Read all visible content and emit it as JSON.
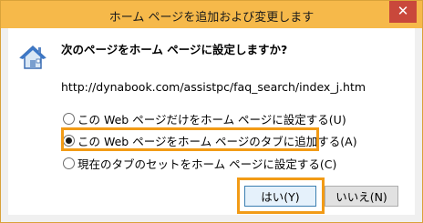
{
  "window": {
    "title": "ホーム ページを追加および変更します",
    "close_glyph": "✕"
  },
  "dialog": {
    "icon": "house-icon",
    "question": "次のページをホーム ページに設定しますか?",
    "url": "http://dynabook.com/assistpc/faq_search/index_j.htm",
    "options": [
      {
        "label": "この Web ページだけをホーム ページに設定する(U)",
        "selected": false
      },
      {
        "label": "この Web ページをホーム ページのタブに追加する(A)",
        "selected": true
      },
      {
        "label": "現在のタブのセットをホーム ページに設定する(C)",
        "selected": false
      }
    ],
    "yes_label": "はい(Y)",
    "no_label": "いいえ(N)"
  },
  "colors": {
    "titlebar": "#f6b94a",
    "close_button": "#c9483b",
    "highlight": "#f29b16"
  }
}
